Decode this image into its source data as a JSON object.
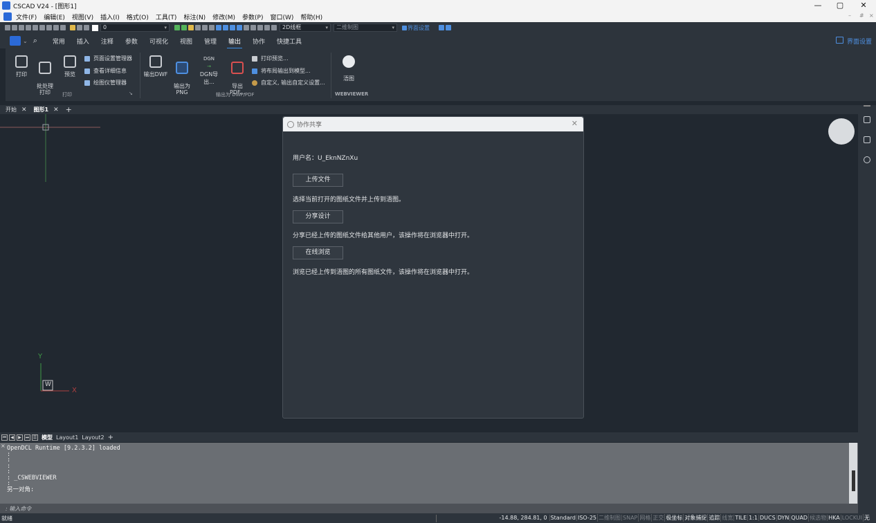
{
  "window": {
    "title": "CSCAD V24 - [图形1]",
    "minimize": "—",
    "maximize": "▢",
    "close": "✕"
  },
  "menu": {
    "items": [
      "文件(F)",
      "编辑(E)",
      "视图(V)",
      "插入(I)",
      "格式(O)",
      "工具(T)",
      "标注(N)",
      "修改(M)",
      "参数(P)",
      "窗口(W)",
      "帮助(H)"
    ],
    "mdi": [
      "–",
      "#",
      "×"
    ]
  },
  "toolbar": {
    "layer": "0",
    "visual_style": "2D线框",
    "workspace": "二维制图",
    "ui_settings": "界面设置"
  },
  "ribbon_tabs": {
    "items": [
      "常用",
      "插入",
      "注释",
      "参数",
      "可视化",
      "视图",
      "管理",
      "输出",
      "协作",
      "快捷工具"
    ],
    "active": "输出",
    "ui_settings": "界面设置"
  },
  "ribbon": {
    "print": "打印",
    "batch_print": "批处理\n打印",
    "preview": "预览",
    "page_setup": "页面设置管理器",
    "view_details": "查看详细信息",
    "plotter_mgr": "绘图仪管理器",
    "group_print": "打印",
    "export_dwf": "输出DWF",
    "export_png": "输出为\nPNG",
    "dgn_export": "DGN导出...",
    "export_pdf": "导出\nPDF...",
    "print_preview": "打印预览...",
    "layout_to_model": "将布局输出到模型...",
    "custom_export": "自定义, 输出自定义设置...",
    "group_export": "输出为 DWF/PDF",
    "dgn_label": "DGN",
    "hybrid": "浯图",
    "group_webviewer": "WEBVIEWER"
  },
  "doc_tabs": {
    "start": "开始",
    "drawing": "图形1",
    "add": "+"
  },
  "dialog": {
    "title": "协作共享",
    "username": "用户名：U_EknNZnXu",
    "upload_btn": "上传文件",
    "upload_desc": "选择当前打开的图纸文件并上传到浯图。",
    "share_btn": "分享设计",
    "share_desc": "分享已经上传的图纸文件给其他用户，该操作将在浏览器中打开。",
    "browse_btn": "在线浏览",
    "browse_desc": "浏览已经上传到浯图的所有图纸文件，该操作将在浏览器中打开。"
  },
  "ucs": {
    "y": "Y",
    "x": "X",
    "w": "W"
  },
  "layout_tabs": {
    "model": "模型",
    "layout1": "Layout1",
    "layout2": "Layout2",
    "add": "+"
  },
  "command": {
    "lines": [
      "OpenDCL Runtime [9.2.3.2] loaded",
      ":",
      ":",
      ":",
      ":",
      ": _CSWEBVIEWER",
      ":",
      "另一对角:"
    ],
    "prompt": ": 输入命令"
  },
  "status": {
    "left": "就绪",
    "coords": "-14.88, 284.81, 0",
    "items": [
      {
        "label": "Standard",
        "on": true
      },
      {
        "label": "ISO-25",
        "on": true
      },
      {
        "label": "二维制图",
        "on": false
      },
      {
        "label": "SNAP",
        "on": false
      },
      {
        "label": "网格",
        "on": false
      },
      {
        "label": "正交",
        "on": false
      },
      {
        "label": "极坐标",
        "on": true
      },
      {
        "label": "对象捕捉",
        "on": true
      },
      {
        "label": "追踪",
        "on": true
      },
      {
        "label": "线宽",
        "on": false
      },
      {
        "label": "TILE",
        "on": true
      },
      {
        "label": "1:1",
        "on": true
      },
      {
        "label": "DUCS",
        "on": true
      },
      {
        "label": "DYN",
        "on": true
      },
      {
        "label": "QUAD",
        "on": true
      },
      {
        "label": "候选物",
        "on": false
      },
      {
        "label": "HKA",
        "on": true
      },
      {
        "label": "LOCKUI",
        "on": false
      },
      {
        "label": "无",
        "on": true
      }
    ]
  }
}
